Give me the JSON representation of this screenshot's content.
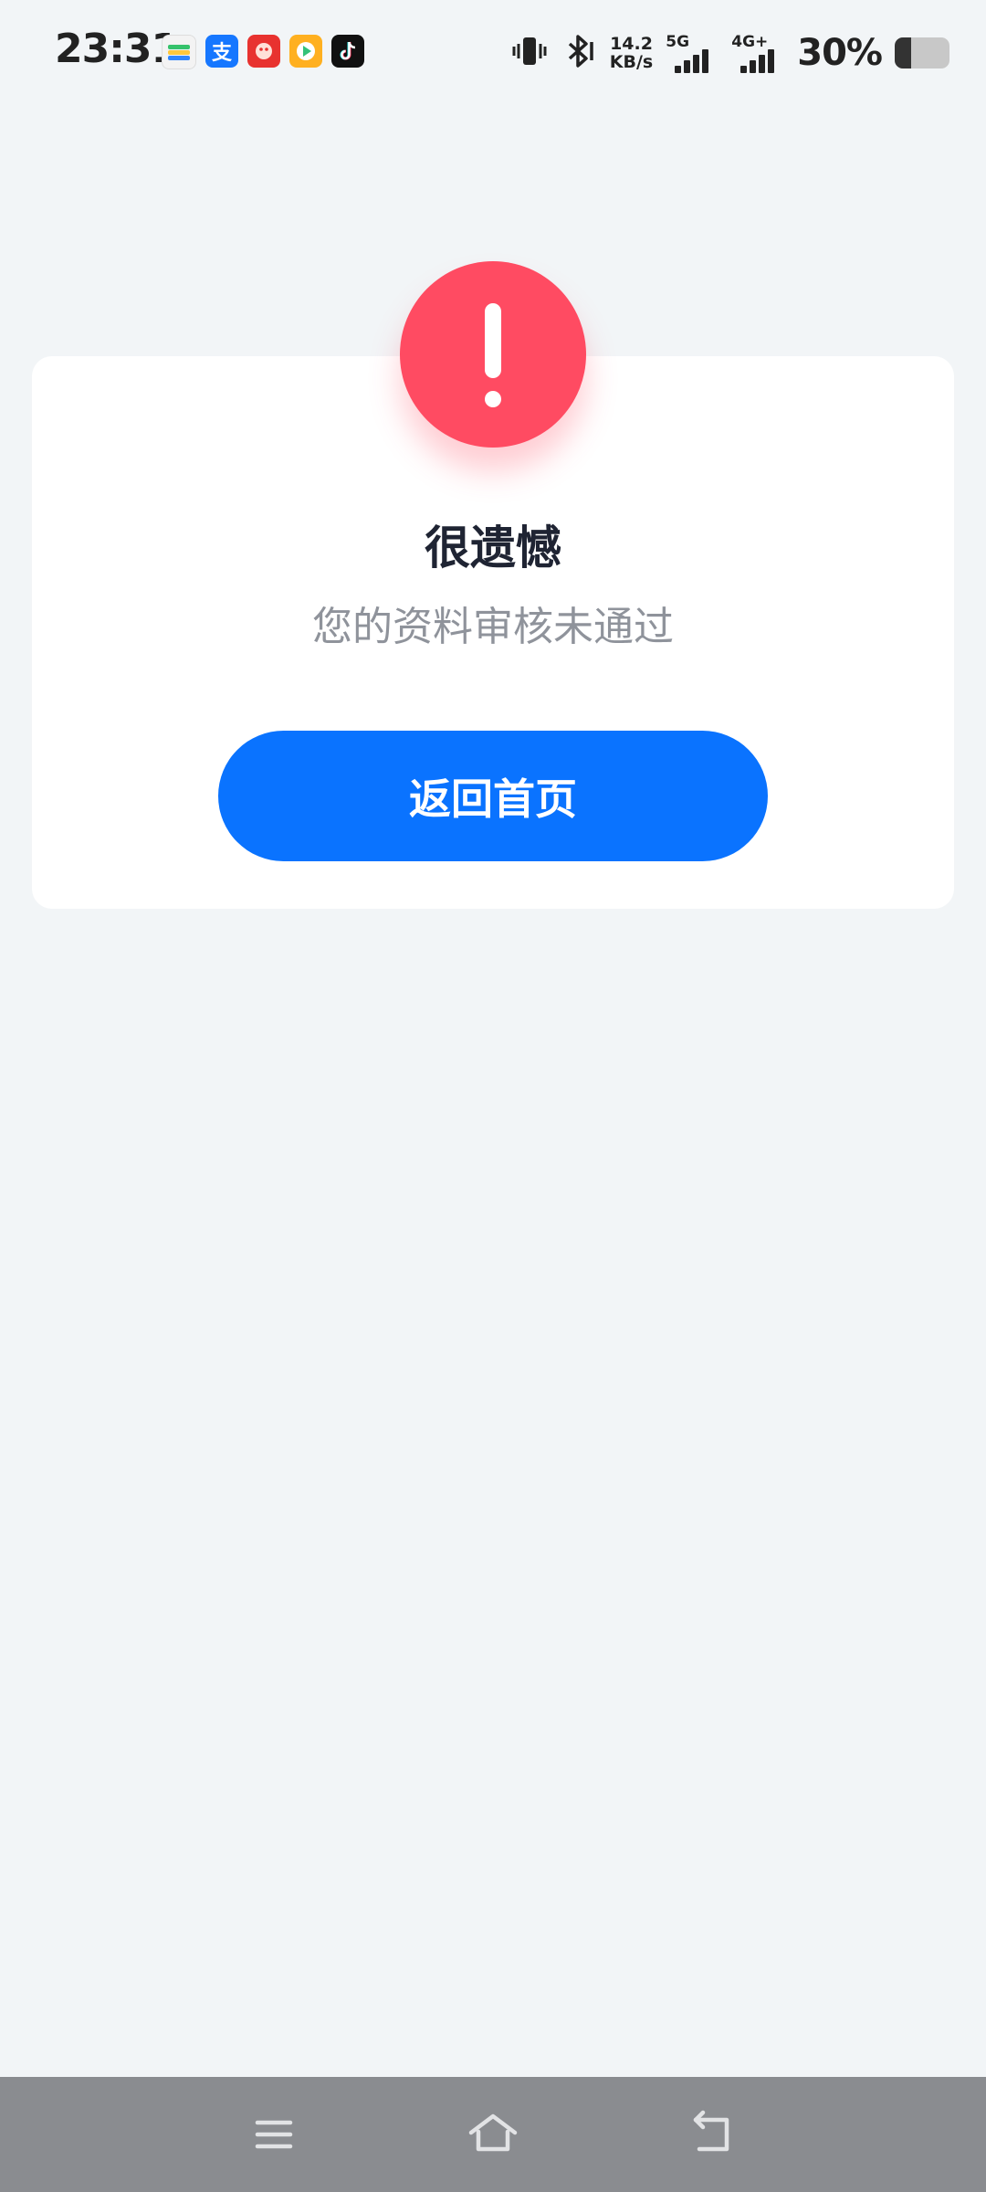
{
  "status_bar": {
    "time": "23:31",
    "app_icons": [
      "wallet-icon",
      "alipay-icon",
      "red-app-icon",
      "video-app-icon",
      "tiktok-icon"
    ],
    "alipay_glyph": "支",
    "speed_value": "14.2",
    "speed_unit": "KB/s",
    "network_1": "5G",
    "network_2": "4G+",
    "battery_text": "30%",
    "battery_level": 0.3
  },
  "result": {
    "title": "很遗憾",
    "description": "您的资料审核未通过",
    "button_label": "返回首页",
    "alert_icon": "exclamation-icon",
    "alert_color": "#ff4b62",
    "button_color": "#0a73ff"
  },
  "navigation_bar": {
    "buttons": [
      "menu-icon",
      "home-icon",
      "back-icon"
    ]
  }
}
